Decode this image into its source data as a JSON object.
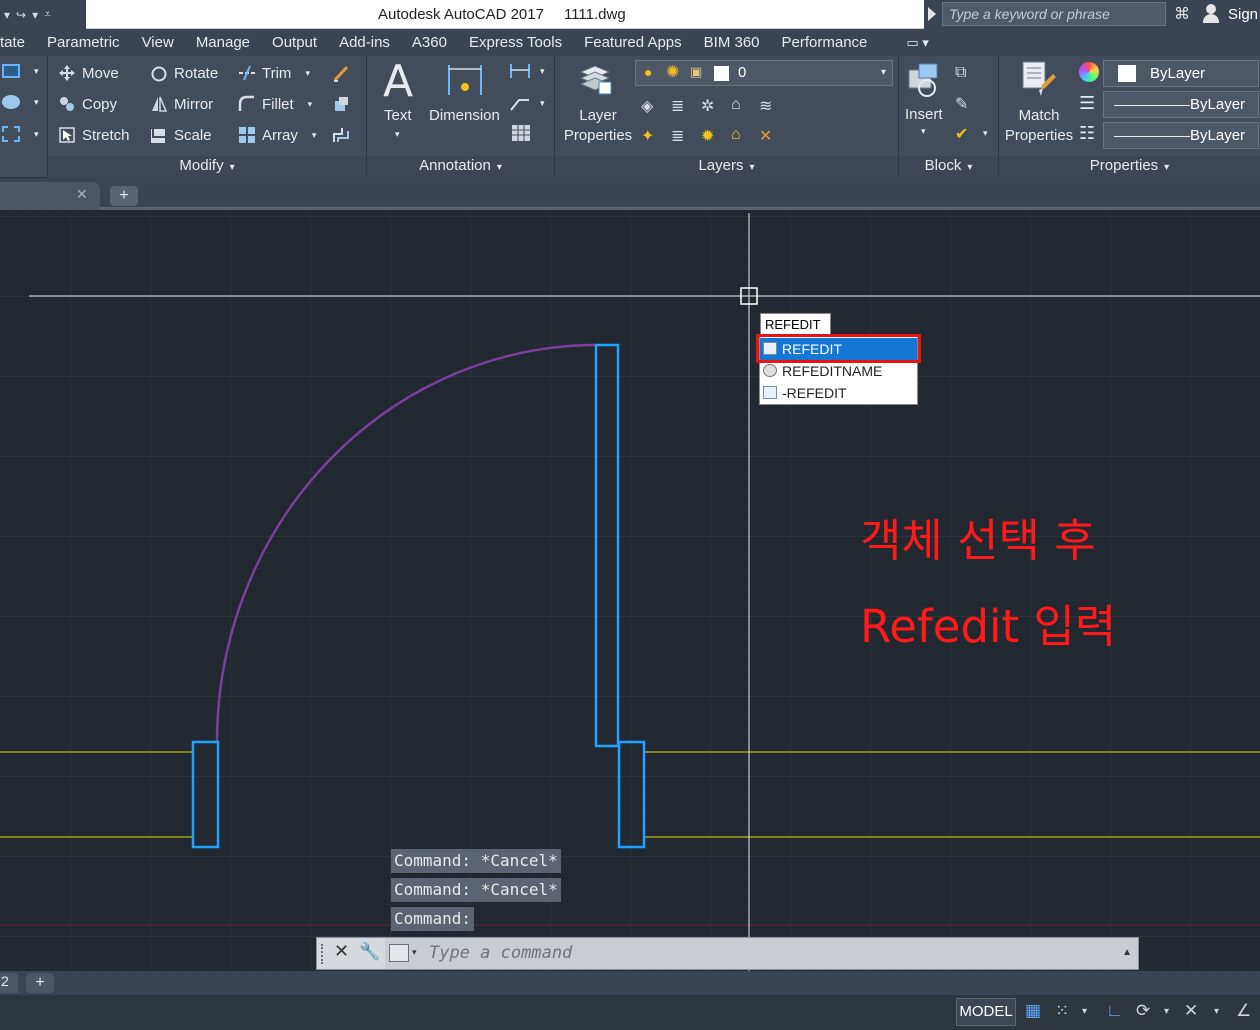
{
  "window": {
    "app_name": "Autodesk AutoCAD 2017",
    "file_name": "1111.dwg",
    "search_placeholder": "Type a keyword or phrase",
    "sign_in": "Sign"
  },
  "ribbon_tabs": [
    "tate",
    "Parametric",
    "View",
    "Manage",
    "Output",
    "Add-ins",
    "A360",
    "Express Tools",
    "Featured Apps",
    "BIM 360",
    "Performance"
  ],
  "modify": {
    "title": "Modify",
    "tools": [
      "Move",
      "Rotate",
      "Trim",
      "Copy",
      "Mirror",
      "Fillet",
      "Stretch",
      "Scale",
      "Array"
    ]
  },
  "annotation": {
    "title": "Annotation",
    "text_label": "Text",
    "dimension_label": "Dimension"
  },
  "layers": {
    "title": "Layers",
    "layer_properties": "Layer Properties",
    "current_layer": "0"
  },
  "block": {
    "title": "Block",
    "insert_label": "Insert"
  },
  "properties": {
    "title": "Properties",
    "match_label": "Match Properties",
    "color_value": "ByLayer",
    "linetype_value": "ByLayer",
    "lineweight_value": "ByLayer"
  },
  "canvas": {
    "typed_command": "REFEDIT",
    "autocomplete": [
      "REFEDIT",
      "REFEDITNAME",
      "-REFEDIT"
    ],
    "selected_suggestion": "REFEDIT",
    "note_line1": "객체 선택 후",
    "note_line2": "Refedit 입력",
    "colors": {
      "selection": "#1fa3ff",
      "arc": "#7b3fa0",
      "wall": "#e2d81a",
      "highlight": "#ee1111",
      "note": "#ff1a1a"
    }
  },
  "command": {
    "history": [
      "Command: *Cancel*",
      "Command: *Cancel*",
      "Command:"
    ],
    "placeholder": "Type a command"
  },
  "layout_tabs": {
    "current": "2"
  },
  "status_bar": {
    "model": "MODEL"
  }
}
